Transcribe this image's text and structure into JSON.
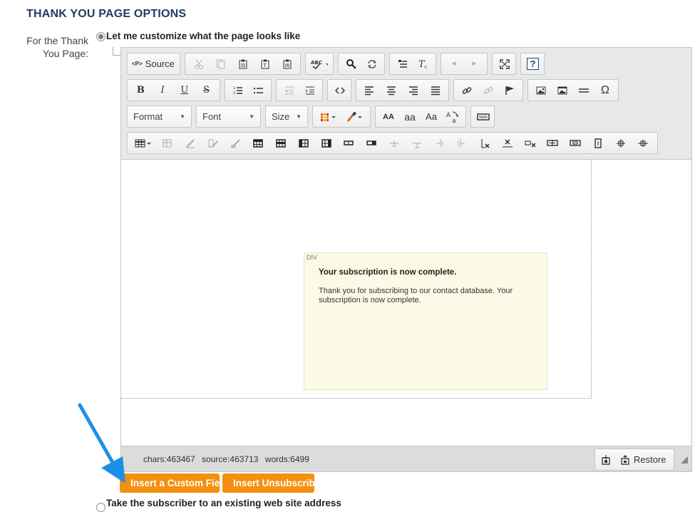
{
  "section": {
    "title": "THANK YOU PAGE OPTIONS"
  },
  "field": {
    "label": "For the Thank You Page:"
  },
  "options": [
    {
      "label": "Let me customize what the page looks like",
      "checked": true
    },
    {
      "label": "Take the subscriber to an existing web site address",
      "checked": false
    }
  ],
  "toolbar": {
    "source_label": "Source",
    "source_icon": "<P>",
    "format_label": "Format",
    "font_label": "Font",
    "size_label": "Size",
    "bold": "B",
    "italic": "I",
    "underline": "U",
    "strike": "S",
    "omega": "Ω",
    "font_size_up": "AA",
    "font_size_down": "aa",
    "title_case": "Aa",
    "help": "?"
  },
  "editor": {
    "div_tag": "DIV",
    "message_heading": "Your subscription is now complete.",
    "message_body": "Thank you for subscribing to our contact database. Your subscription is now complete."
  },
  "statusbar": {
    "chars": "chars:463467",
    "source": "source:463713",
    "words": "words:6499",
    "restore_label": "Restore"
  },
  "buttons": {
    "insert_custom_field": "Insert a Custom Field",
    "insert_unsubscribe": "Insert Unsubscribe Link"
  },
  "colors": {
    "accent_orange": "#f5900f",
    "title_navy": "#1f3a5f",
    "arrow_blue": "#1e8fe6",
    "note_yellow": "#fcfae6"
  }
}
